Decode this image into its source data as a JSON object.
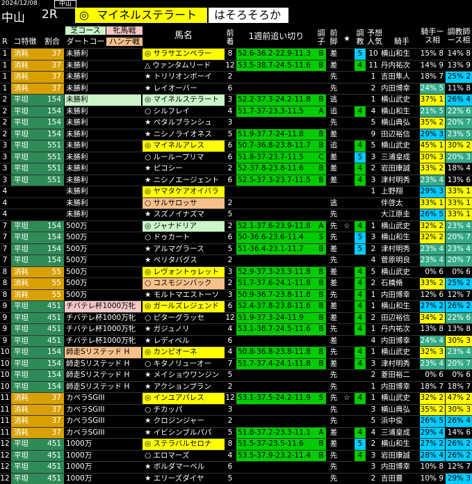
{
  "header": {
    "date": "2024/12/08",
    "course_small": "中山",
    "venue": "中山",
    "race_no": "2R",
    "honmei_mark": "◎",
    "honmei_name": "マイネルステラート",
    "tag": "はそろそろか"
  },
  "columns": {
    "r": "R",
    "cond": "コ特徴",
    "score": "割合",
    "prev_top": "芝コース",
    "prev_bottom": "ダートコー",
    "sex_top": "牝馬戦",
    "sex_bottom": "ハンデ戦",
    "horse": "馬名",
    "pos": "前着",
    "time": "1週前追い切り",
    "grade": "調子",
    "ashi": "前脚",
    "star": "★",
    "cho": "調教",
    "pop": "予想人気",
    "jockey": "騎手",
    "jk": "騎手ース相",
    "tr": "調教師ース相"
  },
  "rows": [
    {
      "r": "1",
      "cond": "消耗",
      "score": "37",
      "prev": "未勝利",
      "horse": "◎ サラサエンペラー",
      "pos": "8",
      "time": "52.6-36.2-22.9-11.3",
      "grade": "B",
      "ashi": "差",
      "star": "",
      "cho": "5",
      "pop": "10",
      "jockey": "横山和生",
      "jk": "15% 8",
      "tr": "14% 8"
    },
    {
      "r": "1",
      "cond": "消耗",
      "score": "37",
      "prev": "未勝利",
      "horse": "△ ウァンタムリード",
      "pos": "12",
      "time": "53.5-38.7-24.5-11.6",
      "grade": "B",
      "ashi": "差",
      "star": "",
      "cho": "4",
      "pop": "11",
      "jockey": "丹内祐次",
      "jk": "14% 9",
      "tr": "13% 9"
    },
    {
      "r": "1",
      "cond": "消耗",
      "score": "37",
      "prev": "未勝利",
      "horse": "★ トリリオンボーイ",
      "pos": "2",
      "time": "",
      "grade": "",
      "ashi": "先",
      "star": "",
      "cho": "",
      "pop": "1",
      "jockey": "吉田隼人",
      "jk": "18% 7",
      "tr": "25% 2"
    },
    {
      "r": "1",
      "cond": "消耗",
      "score": "37",
      "prev": "未勝利",
      "horse": "★ レイオーバー",
      "pos": "6",
      "time": "",
      "grade": "",
      "ashi": "先",
      "star": "",
      "cho": "",
      "pop": "2",
      "jockey": "内田博幸",
      "jk": "24% 5",
      "tr": "11% 8"
    },
    {
      "r": "2",
      "cond": "平坦",
      "score": "154",
      "prev": "未勝利",
      "horse": "◎ マイネルステラート",
      "pos": "3",
      "time": "52.2-37.3-24.2-11.8",
      "grade": "B",
      "ashi": "逃",
      "star": "",
      "cho": "",
      "pop": "1",
      "jockey": "横山武史",
      "jk": "37% 1",
      "tr": "26% 4"
    },
    {
      "r": "2",
      "cond": "平坦",
      "score": "154",
      "prev": "未勝利",
      "horse": "○ シルフレイ",
      "pos": "4",
      "time": "51.7-37-23.3-11.5",
      "grade": "A",
      "ashi": "追",
      "star": "",
      "cho": "4",
      "pop": "4",
      "jockey": "横山和生",
      "jk": "21% 5",
      "tr": "22% 6"
    },
    {
      "r": "2",
      "cond": "平坦",
      "score": "154",
      "prev": "未勝利",
      "horse": "★ ペタルブランシュ",
      "pos": "3",
      "time": "",
      "grade": "",
      "ashi": "先",
      "star": "",
      "cho": "",
      "pop": "5",
      "jockey": "横山典弘",
      "jk": "35% 2",
      "tr": "20% 7"
    },
    {
      "r": "2",
      "cond": "平坦",
      "score": "154",
      "prev": "未勝利",
      "horse": "★ ニシノライオネス",
      "pos": "5",
      "time": "51.9-37.7-24-11.8",
      "grade": "B",
      "ashi": "差",
      "star": "",
      "cho": "",
      "pop": "9",
      "jockey": "田辺裕信",
      "jk": "29% 3",
      "tr": "23% 5"
    },
    {
      "r": "3",
      "cond": "平坦",
      "score": "551",
      "prev": "未勝利",
      "horse": "◎ マイネルアレス",
      "pos": "6",
      "time": "50.7-36.8-23.8-11.7",
      "grade": "B",
      "ashi": "追",
      "star": "",
      "cho": "4",
      "pop": "5",
      "jockey": "横山武史",
      "jk": "45% 1",
      "tr": "30% 2"
    },
    {
      "r": "3",
      "cond": "平坦",
      "score": "551",
      "prev": "未勝利",
      "horse": "○ ルーループリマ",
      "pos": "6",
      "time": "51.8-37-23.7-11.5",
      "grade": "C",
      "ashi": "差",
      "star": "",
      "cho": "5",
      "pop": "3",
      "jockey": "三浦皇成",
      "jk": "30% 3",
      "tr": "20% 3"
    },
    {
      "r": "3",
      "cond": "平坦",
      "score": "551",
      "prev": "未勝利",
      "horse": "★ ピコシー",
      "pos": "2",
      "time": "52-37.8-23.8-11.6",
      "grade": "B",
      "ashi": "差",
      "star": "",
      "cho": "4",
      "pop": "2",
      "jockey": "岩田康誠",
      "jk": "33% 2",
      "tr": "18% 4"
    },
    {
      "r": "3",
      "cond": "平坦",
      "score": "551",
      "prev": "未勝利",
      "horse": "★ ニシノエージェント",
      "pos": "6",
      "time": "52.5-37.3-23.7-11.5",
      "grade": "B",
      "ashi": "差",
      "star": "",
      "cho": "4",
      "pop": "3",
      "jockey": "津村明秀",
      "jk": "23% 4",
      "tr": "13% 6"
    },
    {
      "r": "4",
      "cond": "",
      "score": "",
      "prev": "未勝利",
      "horse": "◎ ヤマタケアオイバラ",
      "pos": "",
      "time": "",
      "grade": "",
      "ashi": "",
      "star": "",
      "cho": "",
      "pop": "1",
      "jockey": "上野翔",
      "jk": "29% 3",
      "tr": "33% 1"
    },
    {
      "r": "4",
      "cond": "",
      "score": "",
      "prev": "未勝利",
      "horse": "○ サルサロッサ",
      "pos": "2",
      "time": "",
      "grade": "",
      "ashi": "逃",
      "star": "",
      "cho": "",
      "pop": "",
      "jockey": "伴啓太",
      "jk": "33% 1",
      "tr": "33% 1"
    },
    {
      "r": "4",
      "cond": "",
      "score": "",
      "prev": "未勝利",
      "horse": "★ スズノイナズマ",
      "pos": "5",
      "time": "",
      "grade": "",
      "ashi": "先",
      "star": "",
      "cho": "",
      "pop": "",
      "jockey": "大江原圭",
      "jk": "26% 5",
      "tr": "33% 1"
    },
    {
      "r": "7",
      "cond": "平坦",
      "score": "154",
      "prev": "500万",
      "horse": "◎ ジャナドリア",
      "pos": "2",
      "time": "52.1-37.6-23.9-11.8",
      "grade": "A",
      "ashi": "先",
      "star": "☆",
      "cho": "4",
      "pop": "1",
      "jockey": "横山武史",
      "jk": "32% 2",
      "tr": "23% 4"
    },
    {
      "r": "7",
      "cond": "平坦",
      "score": "154",
      "prev": "500万",
      "horse": "○ ドゥカート",
      "pos": "6",
      "time": "50-36.6-23.6-11.4",
      "grade": "S",
      "ashi": "先",
      "star": "",
      "cho": "5",
      "pop": "3",
      "jockey": "横山和生",
      "jk": "32% 2",
      "tr": "20% 7"
    },
    {
      "r": "7",
      "cond": "平坦",
      "score": "154",
      "prev": "500万",
      "horse": "★ アルマグラース",
      "pos": "5",
      "time": "51-36.4-23.1-11.7",
      "grade": "B",
      "ashi": "差",
      "star": "",
      "cho": "5",
      "pop": "2",
      "jockey": "津村明秀",
      "jk": "23% 4",
      "tr": "23% 4"
    },
    {
      "r": "7",
      "cond": "平坦",
      "score": "154",
      "prev": "500万",
      "horse": "★ ペリタバグス",
      "pos": "2",
      "time": "",
      "grade": "",
      "ashi": "先",
      "star": "",
      "cho": "",
      "pop": "4",
      "jockey": "菅原明良",
      "jk": "23% 4",
      "tr": "20% 7"
    },
    {
      "r": "8",
      "cond": "消耗",
      "score": "55",
      "prev": "500万",
      "horse": "◎ レヴォントゥレット",
      "pos": "3",
      "time": "52.9-37.3-23.3-11.8",
      "grade": "B",
      "ashi": "差",
      "star": "",
      "cho": "4",
      "pop": "5",
      "jockey": "横山武史",
      "jk": "0% 6",
      "tr": "0% 6"
    },
    {
      "r": "8",
      "cond": "消耗",
      "score": "55",
      "prev": "500万",
      "horse": "○ コスモジンバック",
      "pos": "2",
      "time": "51.7-37.6-24.1-11.8",
      "grade": "B",
      "ashi": "差",
      "star": "",
      "cho": "4",
      "pop": "2",
      "jockey": "石橋脩",
      "jk": "33% 2",
      "tr": "25% 2"
    },
    {
      "r": "8",
      "cond": "消耗",
      "score": "55",
      "prev": "500万",
      "horse": "★ モルトマエストーソ",
      "pos": "3",
      "time": "50.9-36.7-23.8-11.8",
      "grade": "B",
      "ashi": "先",
      "star": "",
      "cho": "4",
      "pop": "1",
      "jockey": "内田博幸",
      "jk": "12% 6",
      "tr": "12% 7"
    },
    {
      "r": "9",
      "cond": "平坦",
      "score": "451",
      "prev": "チバテレ杯1000万牝",
      "horse": "◎ ガールズレジェンド",
      "pos": "6",
      "time": "52.4-37.8-23.8-11.6",
      "grade": "B",
      "ashi": "差",
      "star": "",
      "cho": "4",
      "pop": "1",
      "jockey": "横山和生",
      "jk": "27% 2",
      "tr": "26% 2"
    },
    {
      "r": "9",
      "cond": "平坦",
      "score": "451",
      "prev": "チバテレ杯1000万牝",
      "horse": "○ ピターグラッセ",
      "pos": "12",
      "time": "51.9-37.3-24-11.9",
      "grade": "B",
      "ashi": "差",
      "star": "",
      "cho": "4",
      "pop": "2",
      "jockey": "田辺裕信",
      "jk": "34% 2",
      "tr": "22% 6"
    },
    {
      "r": "9",
      "cond": "平坦",
      "score": "451",
      "prev": "チバテレ杯1000万牝",
      "horse": "★ ガジュノリ",
      "pos": "4",
      "time": "53.1-38.7-24.5-11.6",
      "grade": "B",
      "ashi": "先",
      "star": "",
      "cho": "4",
      "pop": "1",
      "jockey": "丹内祐次",
      "jk": "13% 8",
      "tr": "13% 8"
    },
    {
      "r": "9",
      "cond": "平坦",
      "score": "451",
      "prev": "チバテレ杯1000万牝",
      "horse": "★ レディベル",
      "pos": "6",
      "time": "",
      "grade": "",
      "ashi": "差",
      "star": "",
      "cho": "",
      "pop": "4",
      "jockey": "内田博幸",
      "jk": "24% 4",
      "tr": "30% 3"
    },
    {
      "r": "10",
      "cond": "平坦",
      "score": "154",
      "prev": "師走Sリステッド H",
      "horse": "◎ カンピオーネ",
      "pos": "4",
      "time": "50.8-36.8-23.8-11.8",
      "grade": "B",
      "ashi": "先",
      "star": "",
      "cho": "4",
      "pop": "1",
      "jockey": "横山武史",
      "jk": "32% 3",
      "tr": "23% 4"
    },
    {
      "r": "10",
      "cond": "平坦",
      "score": "154",
      "prev": "師走Sリステッド H",
      "horse": "○ キタノリューオー",
      "pos": "7",
      "time": "51.7-37.4-24.1-11.8",
      "grade": "B",
      "ashi": "差",
      "star": "",
      "cho": "4",
      "pop": "3",
      "jockey": "津村明秀",
      "jk": "23% 4",
      "tr": "20% 7"
    },
    {
      "r": "10",
      "cond": "平坦",
      "score": "154",
      "prev": "師走Sリステッド H",
      "horse": "★ メイショウワンジン",
      "pos": "5",
      "time": "",
      "grade": "",
      "ashi": "先",
      "star": "",
      "cho": "",
      "pop": "2",
      "jockey": "菱田裕二",
      "jk": "0% 6",
      "tr": "0% 6"
    },
    {
      "r": "10",
      "cond": "平坦",
      "score": "154",
      "prev": "師走Sリステッド H",
      "horse": "★ アクションプラン",
      "pos": "2",
      "time": "",
      "grade": "",
      "ashi": "先",
      "star": "",
      "cho": "",
      "pop": "1",
      "jockey": "内田博幸",
      "jk": "18% 7",
      "tr": "18% 7"
    },
    {
      "r": "11",
      "cond": "消耗",
      "score": "37",
      "prev": "カペラSGIII",
      "horse": "◎ インユアパレス",
      "pos": "12",
      "time": "53.1-37.5-24.2-11.9",
      "grade": "S",
      "ashi": "先",
      "star": "☆",
      "cho": "4",
      "pop": "1",
      "jockey": "横山武史",
      "jk": "32% 2",
      "tr": "47% 2"
    },
    {
      "r": "11",
      "cond": "消耗",
      "score": "37",
      "prev": "カペラSGIII",
      "horse": "○ チカッパ",
      "pos": "3",
      "time": "",
      "grade": "",
      "ashi": "先",
      "star": "",
      "cho": "",
      "pop": "3",
      "jockey": "横山典弘",
      "jk": "35% 2",
      "tr": "30% 3"
    },
    {
      "r": "11",
      "cond": "消耗",
      "score": "37",
      "prev": "カペラSGIII",
      "horse": "★ クロジンジャー",
      "pos": "2",
      "time": "",
      "grade": "",
      "ashi": "先",
      "star": "",
      "cho": "",
      "pop": "5",
      "jockey": "浜中俊",
      "jk": "26% 5",
      "tr": "26% 4"
    },
    {
      "r": "11",
      "cond": "消耗",
      "score": "37",
      "prev": "カペラSGIII",
      "horse": "★ イビシンブルパパ",
      "pos": "5",
      "time": "51.8-37.2-23.3-11.1",
      "grade": "A",
      "ashi": "差",
      "star": "",
      "cho": "4",
      "pop": "4",
      "jockey": "三浦皇成",
      "jk": "29% 4",
      "tr": "14% 6"
    },
    {
      "r": "12",
      "cond": "平坦",
      "score": "451",
      "prev": "1000万",
      "horse": "◎ ステラバルセロナ",
      "pos": "8",
      "time": "51.5-37-23.5-11.6",
      "grade": "B",
      "ashi": "差",
      "star": "",
      "cho": "5",
      "pop": "2",
      "jockey": "横山和生",
      "jk": "27% 2",
      "tr": "26% 2"
    },
    {
      "r": "12",
      "cond": "平坦",
      "score": "451",
      "prev": "1000万",
      "horse": "○ エロマーズ",
      "pos": "4",
      "time": "53.5-37.9-23.2-11.4",
      "grade": "B",
      "ashi": "先",
      "star": "",
      "cho": "4",
      "pop": "3",
      "jockey": "岩田康誠",
      "jk": "28% 4",
      "tr": "26% 2"
    },
    {
      "r": "12",
      "cond": "平坦",
      "score": "451",
      "prev": "1000万",
      "horse": "★ ボルダマーベル",
      "pos": "6",
      "time": "",
      "grade": "",
      "ashi": "先",
      "star": "",
      "cho": "",
      "pop": "3",
      "jockey": "内田博幸",
      "jk": "10% 8",
      "tr": "12% 7"
    },
    {
      "r": "12",
      "cond": "平坦",
      "score": "451",
      "prev": "1000万",
      "horse": "★ エリーズダイヤ",
      "pos": "5",
      "time": "",
      "grade": "",
      "ashi": "先",
      "star": "",
      "cho": "",
      "pop": "2",
      "jockey": "吉田豊",
      "jk": "10% 9",
      "tr": "29% 3"
    }
  ]
}
